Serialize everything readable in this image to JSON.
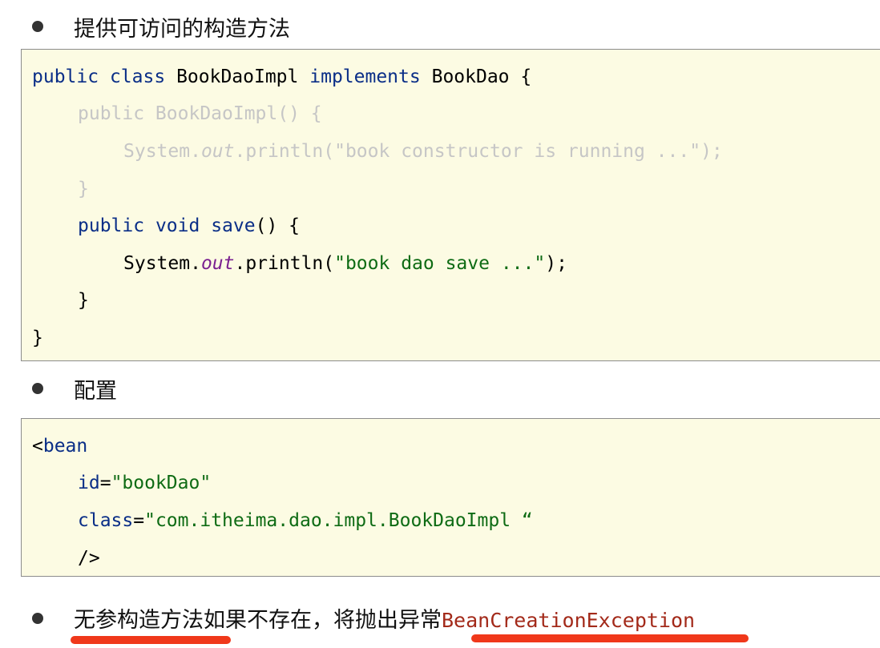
{
  "bullets": {
    "b1": "提供可访问的构造方法",
    "b2": "配置",
    "b3_main": "无参构造方法如果不存在，将抛出异常",
    "b3_exception": "BeanCreationException"
  },
  "code1": {
    "l1_kw1": "public",
    "l1_kw2": "class",
    "l1_name": "BookDaoImpl",
    "l1_kw3": "implements",
    "l1_rest": "BookDao {",
    "l2": "public BookDaoImpl() {",
    "l3_a": "System.",
    "l3_out": "out",
    "l3_b": ".println(\"book constructor is running ...\");",
    "l4": "}",
    "l5_kw1": "public",
    "l5_kw2": "void",
    "l5_name": "save",
    "l5_rest": "() {",
    "l6_a": "System.",
    "l6_out": "out",
    "l6_b": ".println(",
    "l6_str": "\"book dao save ...\"",
    "l6_c": ");",
    "l7": "}",
    "l8": "}"
  },
  "code2": {
    "l1_lt": "<",
    "l1_tag": "bean",
    "l2_attr": "id",
    "l2_eq": "=",
    "l2_val": "\"bookDao\"",
    "l3_attr": "class",
    "l3_eq": "=",
    "l3_val": "\"com.itheima.dao.impl.BookDaoImpl “",
    "l4": "/>"
  },
  "colors": {
    "keyword": "#0a2e87",
    "string": "#0e6b14",
    "static_field": "#7a2090",
    "faded": "#c6c6c6",
    "exception": "#a32a1a",
    "underline": "#f0381a",
    "code_bg": "#fcfbe3"
  }
}
